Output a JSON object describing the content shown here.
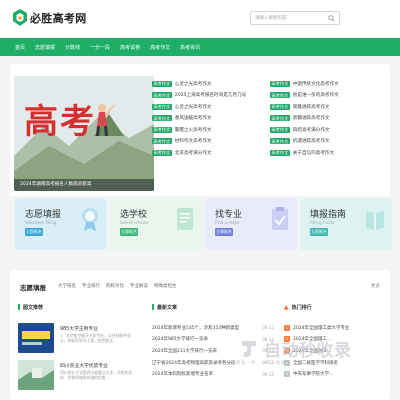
{
  "header": {
    "site_name": "必胜高考网",
    "search_placeholder": "请输入搜索内容"
  },
  "nav": [
    "首页",
    "志愿填报",
    "分数线",
    "一分一段",
    "高考试卷",
    "高考作文",
    "高考资讯"
  ],
  "banner": {
    "big_text": "高考",
    "caption": "2024年湖南高考报名人数再创新高"
  },
  "news_left": [
    {
      "tag": "高考作文",
      "title": "心灵之光高考作文"
    },
    {
      "tag": "高考作文",
      "title": "2025上海高考报名时间是几月几号"
    },
    {
      "tag": "高考作文",
      "title": "心灵之光高考作文"
    },
    {
      "tag": "高考作文",
      "title": "春风送暖高考作文"
    },
    {
      "tag": "高考作文",
      "title": "警醒之火高考作文"
    },
    {
      "tag": "高考作文",
      "title": "材料作文高考作文"
    },
    {
      "tag": "高考作文",
      "title": "北京高考满分作文"
    }
  ],
  "news_right": [
    {
      "tag": "高考作文",
      "title": "中国传统文化高考作文"
    },
    {
      "tag": "高考作文",
      "title": "他是谁一份的高考作文"
    },
    {
      "tag": "高考作文",
      "title": "观雅进踪高考作文"
    },
    {
      "tag": "高考作文",
      "title": "新疆进踪高考作文"
    },
    {
      "tag": "高考作文",
      "title": "四结高考满分作文"
    },
    {
      "tag": "高考作文",
      "title": "机遇进踪高考作文"
    },
    {
      "tag": "高考作文",
      "title": "关于自信的高考作文"
    }
  ],
  "tiles": [
    {
      "title": "志愿填报",
      "sub": "Volunteer filling",
      "button": "立即报名",
      "bg": "#d9eef6",
      "accent": "#35a6d6"
    },
    {
      "title": "选学校",
      "sub": "Select schools",
      "button": "立即报名",
      "bg": "#e8f6ee",
      "accent": "#38b77a"
    },
    {
      "title": "找专业",
      "sub": "Find a major",
      "button": "立即报名",
      "bg": "#e9ebfa",
      "accent": "#6f7fdc"
    },
    {
      "title": "填报指南",
      "sub": "Filling Guide",
      "button": "立即报名",
      "bg": "#dcf3f1",
      "accent": "#3bb9ad"
    }
  ],
  "section": {
    "title": "志愿填报",
    "tabs": [
      "大学排名",
      "专业排行",
      "院校对比",
      "专业解读",
      "特殊类招生"
    ],
    "more": "更多"
  },
  "panels": {
    "featured": "图文推荐",
    "latest": "最新文章",
    "hot": "热门排行"
  },
  "featured_posts": [
    {
      "title": "985大学王牌专业",
      "desc": "1、北京航空航天大学专业，公开材料中显示，材料科学与工程，航空航天..."
    },
    {
      "title": "四川农业大学优势专业",
      "desc": "四川农业大学是四川省重点大学，学校在农科、生物领域有较强的优势..."
    }
  ],
  "latest_articles": [
    {
      "title": "2024年新增专业535个，涉及353种新类型",
      "date": "06-12"
    },
    {
      "title": "2024年985大学排行一览表",
      "date": "06-12"
    },
    {
      "title": "2024年全国211大学排行一览表",
      "date": "06-12"
    },
    {
      "title": "辽宁省2024年高考物理高职及录考各分段",
      "date": "06-12"
    },
    {
      "title": "2024年本科院校新增专业名单",
      "date": "06-12"
    }
  ],
  "hot_list": [
    {
      "num": "1",
      "title": "2024年全国理工类大学专业"
    },
    {
      "num": "2",
      "title": "2024年全国理工..."
    },
    {
      "num": "3",
      "title": "2024年全国985..."
    },
    {
      "num": "4",
      "title": "全国二级医学学科排名"
    },
    {
      "num": "5",
      "title": "中央军事学院大学..."
    }
  ],
  "watermark": {
    "brand": "自动秒收录",
    "slogan": "网站一秒，一次一秒收录"
  }
}
